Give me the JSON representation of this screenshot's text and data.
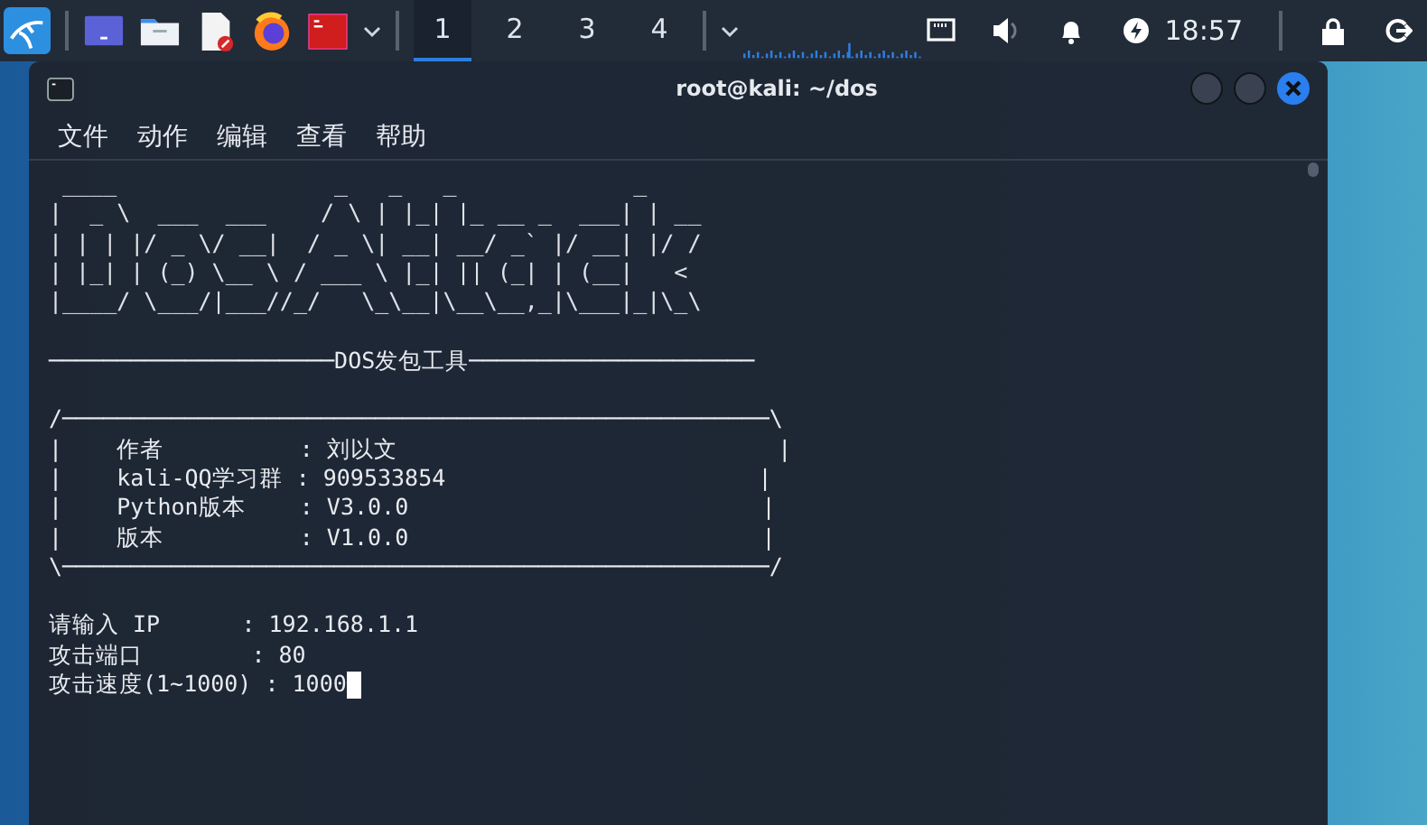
{
  "taskbar": {
    "workspaces": [
      {
        "label": "1",
        "selected": true
      },
      {
        "label": "2",
        "selected": false
      },
      {
        "label": "3",
        "selected": false
      },
      {
        "label": "4",
        "selected": false
      }
    ],
    "clock": "18:57"
  },
  "window": {
    "title": "root@kali: ~/dos"
  },
  "menu": [
    "文件",
    "动作",
    "编辑",
    "查看",
    "帮助"
  ],
  "terminal": {
    "banner": [
      " ____                _   _   _             _",
      "|  _ \\  ___  ___    / \\ | |_| |_ __ _  ___| | __",
      "| | | |/ _ \\/ __|  / _ \\| __| __/ _` |/ __| |/ /",
      "| |_| | (_) \\__ \\ / ___ \\ |_| || (_| | (__|   <",
      "|____/ \\___/|___//_/   \\_\\__|\\__\\__,_|\\___|_|\\_\\"
    ],
    "heading": "─────────────────────DOS发包工具─────────────────────",
    "box": [
      "/────────────────────────────────────────────────────\\",
      "|    作者          : 刘以文                            |",
      "|    kali-QQ学习群 : 909533854                       |",
      "|    Python版本    : V3.0.0                          |",
      "|    版本          : V1.0.0                          |",
      "\\────────────────────────────────────────────────────/"
    ],
    "inputs": [
      "请输入 IP      : 192.168.1.1",
      "攻击端口        : 80",
      "攻击速度(1~1000) : 1000"
    ]
  }
}
